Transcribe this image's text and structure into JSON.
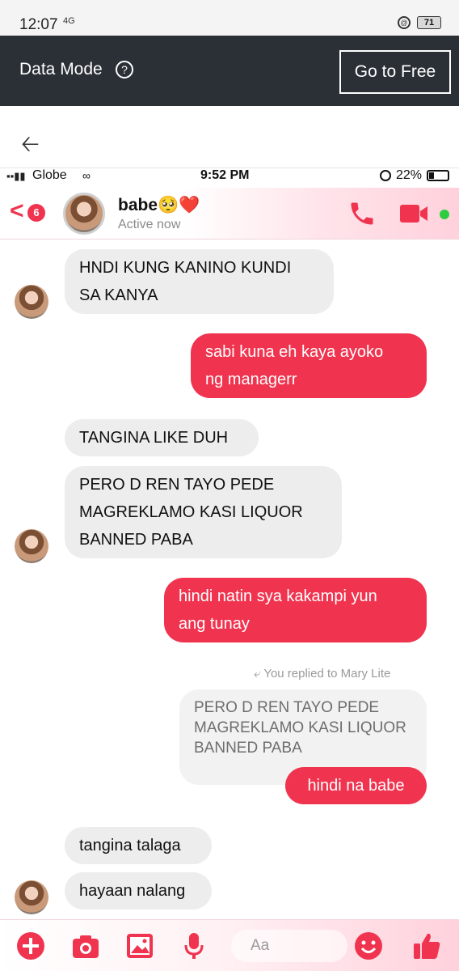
{
  "os_status": {
    "time": "12:07",
    "signal": "4G",
    "battery": "71"
  },
  "data_mode": {
    "label": "Data Mode",
    "help_symbol": "?",
    "button": "Go to Free"
  },
  "ios_status": {
    "carrier": "Globe",
    "time": "9:52 PM",
    "battery": "22%"
  },
  "header": {
    "unread_count": "6",
    "contact_name": "babe🥺❤️",
    "status": "Active now",
    "accent": "#f0344f"
  },
  "messages": [
    {
      "side": "in",
      "text": "HNDI KUNG KANINO KUNDI\nSA KANYA"
    },
    {
      "side": "out",
      "text": "sabi kuna eh kaya ayoko\nng managerr"
    },
    {
      "side": "in",
      "text": "TANGINA LIKE DUH"
    },
    {
      "side": "in",
      "text": "PERO D REN TAYO PEDE\nMAGREKLAMO KASI LIQUOR\nBANNED PABA"
    },
    {
      "side": "out",
      "text": "hindi natin sya kakampi yun\nang tunay"
    },
    {
      "side": "out",
      "text": "hindi na babe"
    },
    {
      "side": "in",
      "text": "tangina talaga"
    },
    {
      "side": "in",
      "text": "hayaan nalang"
    }
  ],
  "reply": {
    "note": "You replied to Mary Lite",
    "quoted": "PERO D REN TAYO PEDE\nMAGREKLAMO KASI LIQUOR\nBANNED PABA"
  },
  "composer": {
    "placeholder": "Aa",
    "icons": [
      "plus-icon",
      "camera-icon",
      "image-icon",
      "microphone-icon",
      "emoji-icon",
      "thumbs-up-icon"
    ]
  }
}
